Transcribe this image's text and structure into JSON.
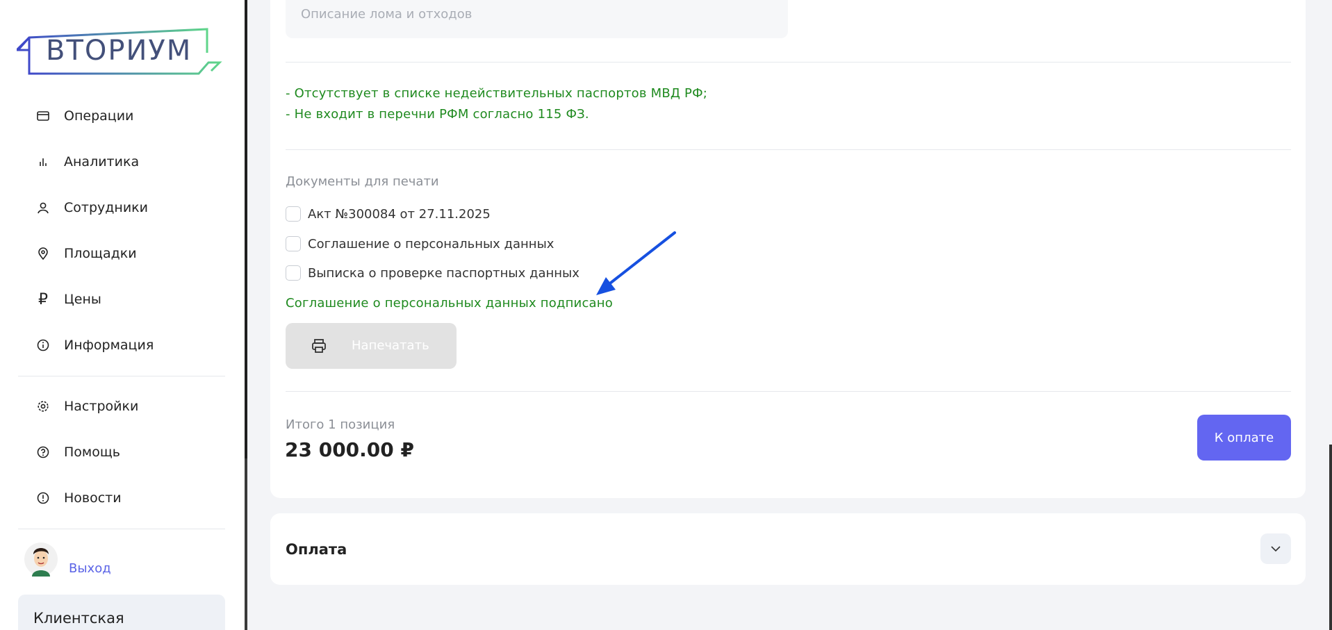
{
  "brand": {
    "logo_text": "ВТОРИУМ"
  },
  "sidebar": {
    "items": [
      {
        "label": "Операции",
        "icon": "card-icon"
      },
      {
        "label": "Аналитика",
        "icon": "bar-chart-icon"
      },
      {
        "label": "Сотрудники",
        "icon": "user-icon"
      },
      {
        "label": "Площадки",
        "icon": "location-pin-icon"
      },
      {
        "label": "Цены",
        "icon": "ruble-icon"
      },
      {
        "label": "Информация",
        "icon": "info-icon"
      }
    ],
    "bottom_items": [
      {
        "label": "Настройки",
        "icon": "gear-icon"
      },
      {
        "label": "Помощь",
        "icon": "help-icon"
      },
      {
        "label": "Новости",
        "icon": "alert-icon"
      }
    ],
    "logout_label": "Выход",
    "client_box_label": "Клиентская"
  },
  "main": {
    "description_placeholder": "Описание лома и отходов",
    "check_results": [
      "- Отсутствует в списке недействительных паспортов МВД РФ;",
      "- Не входит в перечни РФМ согласно 115 ФЗ."
    ],
    "documents_title": "Документы для печати",
    "documents": [
      {
        "label": "Акт №300084 от 27.11.2025",
        "checked": false
      },
      {
        "label": "Соглашение о персональных данных",
        "checked": false
      },
      {
        "label": "Выписка о проверке паспортных данных",
        "checked": false
      }
    ],
    "agreement_status": "Соглашение о персональных данных подписано",
    "print_button": "Напечатать",
    "total_label": "Итого 1 позиция",
    "total_value": "23 000.00 ₽",
    "pay_button": "К оплате"
  },
  "payment_section": {
    "title": "Оплата"
  },
  "colors": {
    "accent": "#6366f1",
    "success_text": "#1f8a1f",
    "annotation_arrow": "#1650e0"
  }
}
